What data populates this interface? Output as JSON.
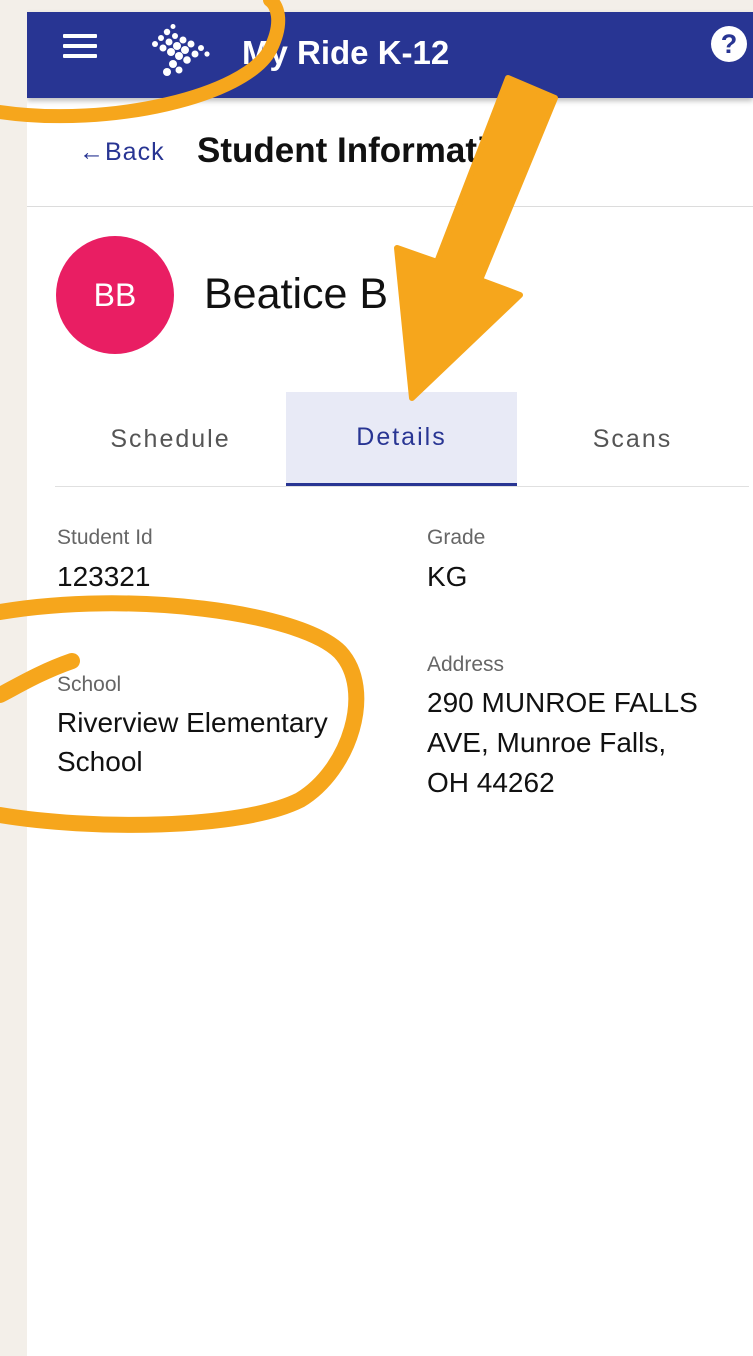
{
  "appbar": {
    "title": "My Ride K-12",
    "menu_icon": "hamburger-menu-icon",
    "logo_icon": "dots-logo-icon",
    "help_icon": "question-mark-icon",
    "help_label": "?"
  },
  "header": {
    "back_label": "←Back",
    "title": "Student Information"
  },
  "student": {
    "initials": "BB",
    "name": "Beatice B",
    "avatar_color": "#e91e63"
  },
  "tabs": [
    {
      "label": "Schedule",
      "active": false
    },
    {
      "label": "Details",
      "active": true
    },
    {
      "label": "Scans",
      "active": false
    }
  ],
  "details": {
    "student_id_label": "Student Id",
    "student_id_value": "123321",
    "grade_label": "Grade",
    "grade_value": "KG",
    "school_label": "School",
    "school_value_line1": "Riverview Elementary",
    "school_value_line2": "School",
    "address_label": "Address",
    "address_line1": "290 MUNROE FALLS",
    "address_line2": "AVE, Munroe Falls,",
    "address_line3": "OH 44262"
  },
  "colors": {
    "primary": "#283593",
    "annotation": "#f6a61c",
    "active_tab_bg": "#e8eaf6"
  }
}
